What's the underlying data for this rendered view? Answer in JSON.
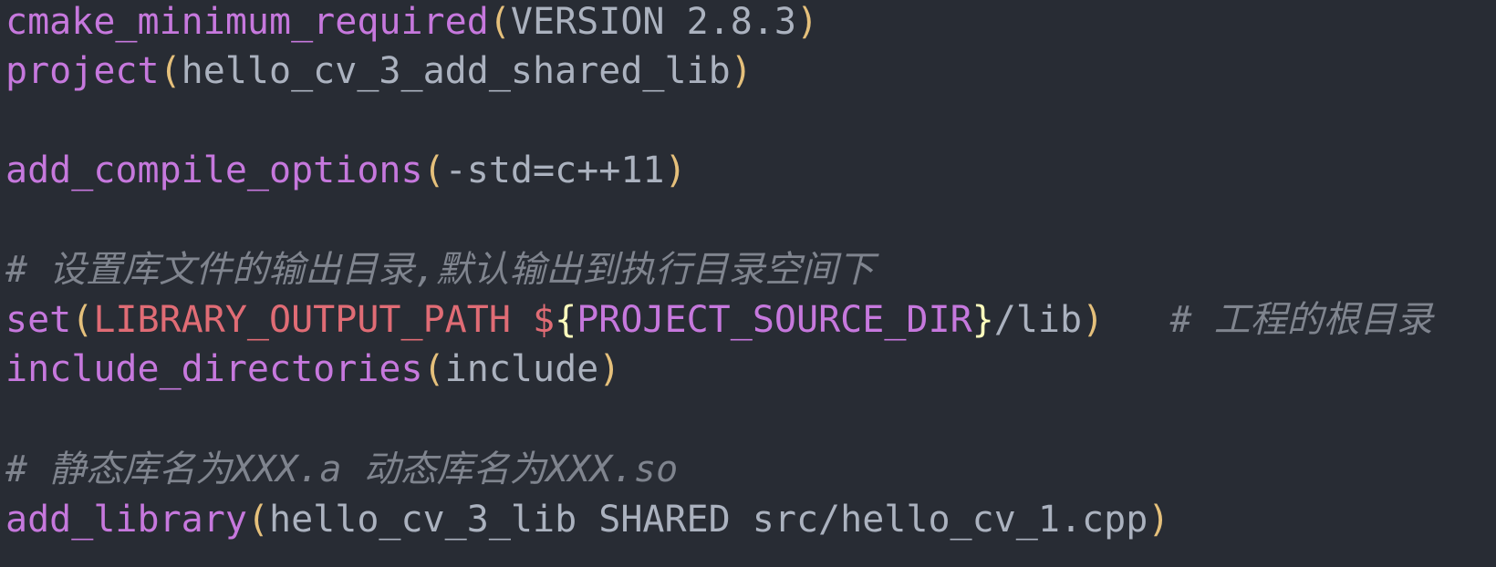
{
  "editor": {
    "colors": {
      "background": "#282c34",
      "function": "#c678dd",
      "paren": "#e5c07b",
      "text": "#abb2bf",
      "variable": "#e06c75",
      "brace": "#ffffbd",
      "comment": "#7f848e"
    },
    "lines": [
      {
        "fn": "cmake_minimum_required",
        "open": "(",
        "arg": "VERSION 2.8.3",
        "close": ")"
      },
      {
        "fn": "project",
        "open": "(",
        "arg": "hello_cv_3_add_shared_lib",
        "close": ")"
      },
      {
        "fn": "add_compile_options",
        "open": "(",
        "arg": "-std=c++11",
        "close": ")"
      },
      {
        "comment": "# 设置库文件的输出目录,默认输出到执行目录空间下"
      },
      {
        "fn": "set",
        "open": "(",
        "var": "LIBRARY_OUTPUT_PATH",
        "space": " ",
        "dollar": "$",
        "brace_open": "{",
        "var2": "PROJECT_SOURCE_DIR",
        "brace_close": "}",
        "tail": "/lib",
        "close": ")",
        "gap": "   ",
        "comment": "# 工程的根目录"
      },
      {
        "fn": "include_directories",
        "open": "(",
        "arg": "include",
        "close": ")"
      },
      {
        "comment": "# 静态库名为XXX.a 动态库名为XXX.so"
      },
      {
        "fn": "add_library",
        "open": "(",
        "arg": "hello_cv_3_lib SHARED src/hello_cv_1.cpp",
        "close": ")"
      }
    ]
  }
}
